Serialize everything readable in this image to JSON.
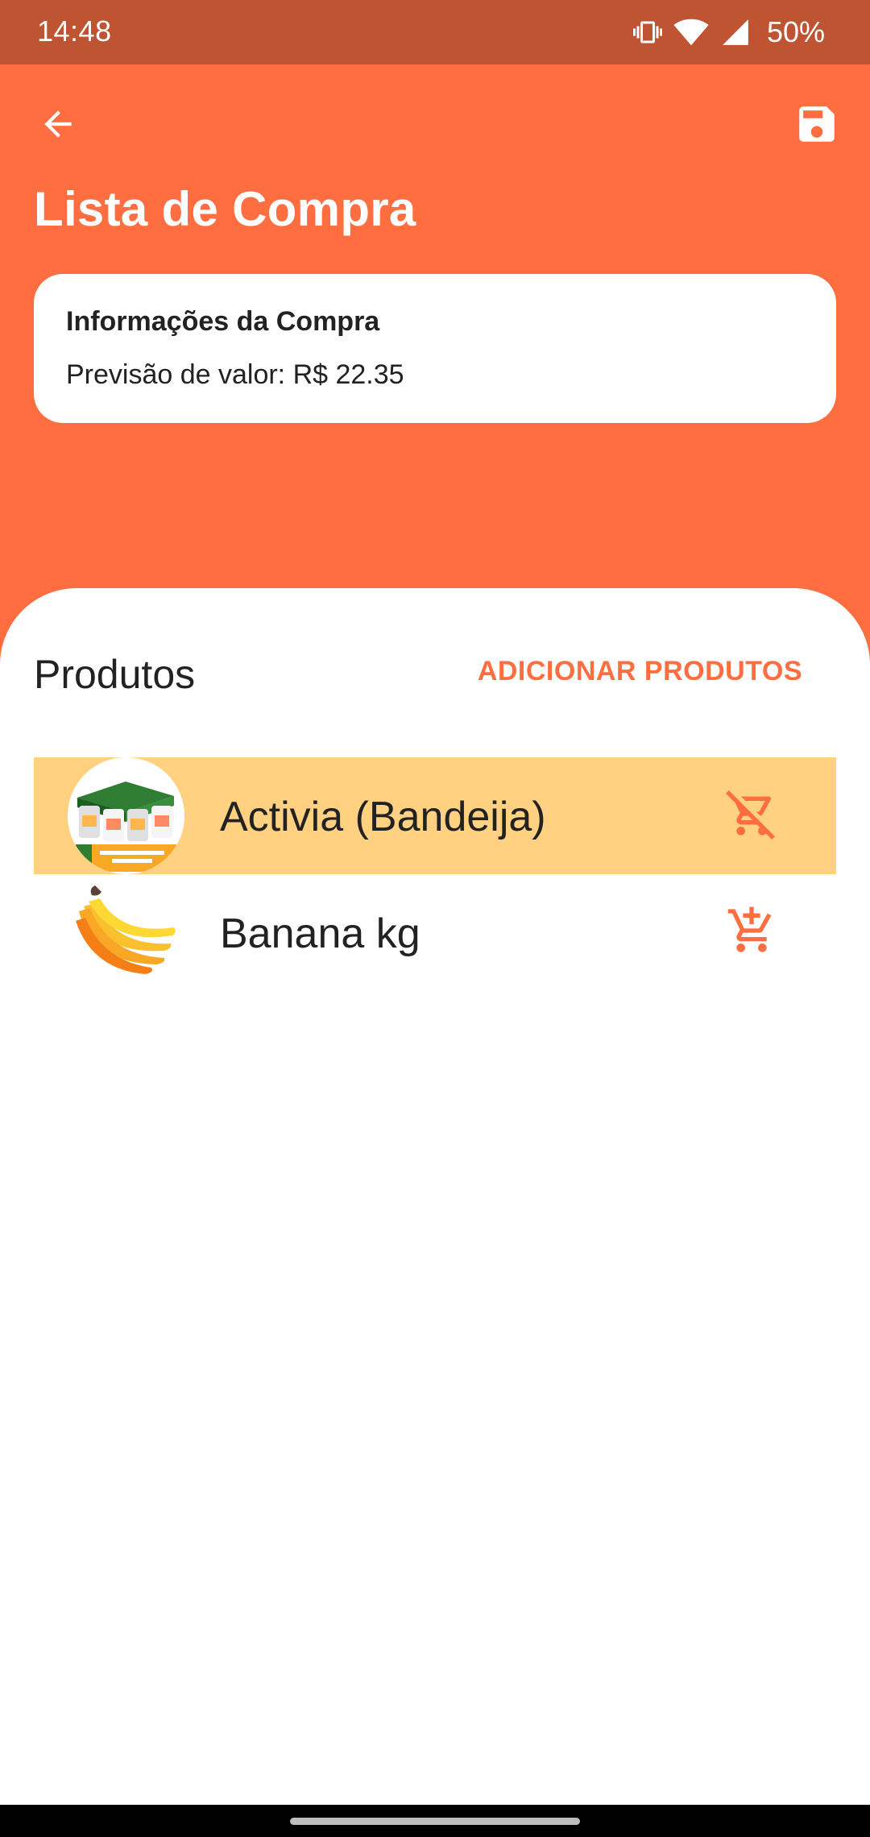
{
  "status_bar": {
    "time": "14:48",
    "battery": "50%"
  },
  "app_bar": {
    "back_icon": "arrow-back-icon",
    "save_icon": "floppy-save-icon",
    "title": "Lista de Compra"
  },
  "info_card": {
    "title": "Informações da Compra",
    "estimate": "Previsão de valor: R$ 22.35"
  },
  "products_section": {
    "title": "Produtos",
    "add_button": "ADICIONAR PRODUTOS",
    "items": [
      {
        "name": "Activia (Bandeija)",
        "image": "yogurt-tray-image",
        "action_icon": "remove-from-cart-icon",
        "selected": true
      },
      {
        "name": "Banana kg",
        "image": "banana-bunch-image",
        "action_icon": "add-to-cart-icon",
        "selected": false
      }
    ]
  },
  "colors": {
    "accent": "#ff6e40",
    "status_bar": "#bf5433",
    "selected_row": "#ffd180"
  }
}
